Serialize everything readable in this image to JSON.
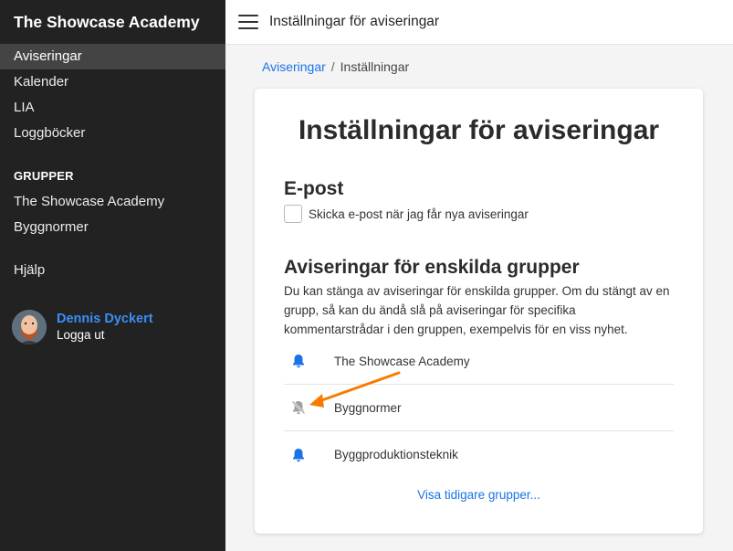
{
  "sidebar": {
    "brand": "The Showcase Academy",
    "nav": [
      {
        "label": "Aviseringar",
        "active": true
      },
      {
        "label": "Kalender"
      },
      {
        "label": "LIA"
      },
      {
        "label": "Loggböcker"
      }
    ],
    "groups_title": "GRUPPER",
    "groups": [
      {
        "label": "The Showcase Academy"
      },
      {
        "label": "Byggnormer"
      }
    ],
    "help": "Hjälp",
    "user": {
      "name": "Dennis Dyckert",
      "logout": "Logga ut"
    }
  },
  "topbar": {
    "title": "Inställningar för aviseringar"
  },
  "breadcrumb": {
    "parent": "Aviseringar",
    "separator": "/",
    "current": "Inställningar"
  },
  "card": {
    "title": "Inställningar för aviseringar",
    "email_heading": "E-post",
    "email_checkbox_label": "Skicka e-post när jag får nya aviseringar",
    "email_checked": false,
    "groups_heading": "Aviseringar för enskilda grupper",
    "groups_description": "Du kan stänga av aviseringar för enskilda grupper. Om du stängt av en grupp, så kan du ändå slå på aviseringar för specifika kommentarstrådar i den gruppen, exempelvis för en viss nyhet.",
    "groups": [
      {
        "name": "The Showcase Academy",
        "icon": "bell-icon"
      },
      {
        "name": "Byggnormer",
        "icon": "bell-slash-icon"
      },
      {
        "name": "Byggproduktionsteknik",
        "icon": "bell-icon"
      }
    ],
    "more_link": "Visa tidigare grupper..."
  },
  "colors": {
    "sidebar_bg": "#222222",
    "sidebar_active": "#444444",
    "link": "#1a73e8",
    "bell_on": "#1a73e8",
    "bell_off": "#999999",
    "arrow": "#f57c00"
  }
}
